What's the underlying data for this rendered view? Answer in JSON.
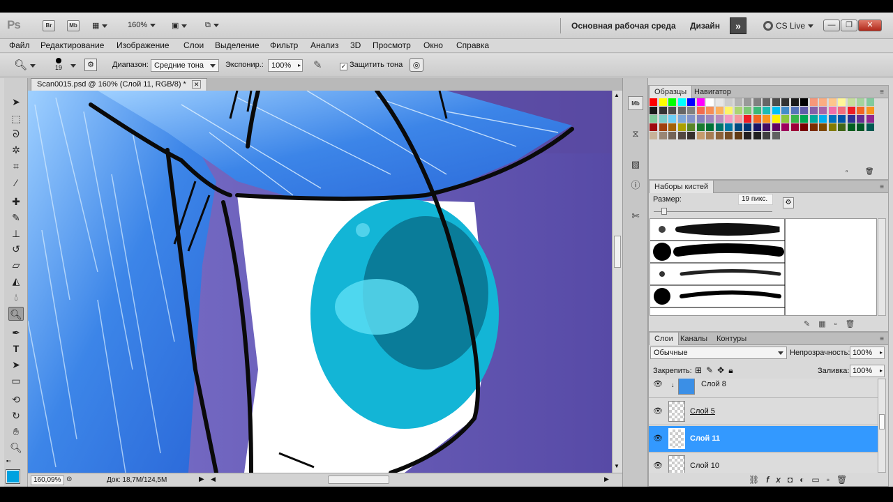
{
  "app": {
    "logo": "Ps",
    "bridge": "Br",
    "minibridge": "Mb",
    "zoom_select": "160%",
    "workspace": "Основная рабочая среда",
    "design": "Дизайн",
    "cslive": "CS Live"
  },
  "menu": [
    "Файл",
    "Редактирование",
    "Изображение",
    "Слои",
    "Выделение",
    "Фильтр",
    "Анализ",
    "3D",
    "Просмотр",
    "Окно",
    "Справка"
  ],
  "options": {
    "brush_size": "19",
    "range_label": "Диапазон:",
    "range_value": "Средние тона",
    "exposure_label": "Экспонир.:",
    "exposure_value": "100%",
    "protect_tones": "Защитить тона"
  },
  "document": {
    "tab_title": "Scan0015.psd @ 160% (Слой 11, RGB/8) *",
    "zoom": "160,09%",
    "doc_info": "Док: 18,7M/124,5M"
  },
  "panels": {
    "swatches_tab": "Образцы",
    "navigator_tab": "Навигатор",
    "brush_presets_tab": "Наборы кистей",
    "size_label": "Размер:",
    "size_value": "19 пикс.",
    "layers_tab": "Слои",
    "channels_tab": "Каналы",
    "paths_tab": "Контуры",
    "blend_mode": "Обычные",
    "opacity_label": "Непрозрачность:",
    "opacity_value": "100%",
    "lock_label": "Закрепить:",
    "fill_label": "Заливка:",
    "fill_value": "100%"
  },
  "layers": [
    {
      "name": "Слой 8",
      "selected": false
    },
    {
      "name": "Слой 5",
      "selected": false
    },
    {
      "name": "Слой 11",
      "selected": true
    },
    {
      "name": "Слой 10",
      "selected": false
    }
  ],
  "colors": {
    "accent": "#3399ff",
    "foreground": "#00a2e0",
    "canvas_bg": "#7a6cc4",
    "hair": "#3d86e6",
    "iris": "#16b9d8"
  },
  "icons": [
    "zoom-icon",
    "move-icon",
    "marquee-icon",
    "lasso-icon",
    "quick-select-icon",
    "crop-icon",
    "eyedropper-icon",
    "healing-icon",
    "brush-icon",
    "stamp-icon",
    "history-brush-icon",
    "eraser-icon",
    "gradient-icon",
    "blur-icon",
    "dodge-icon",
    "pen-icon",
    "type-icon",
    "path-select-icon",
    "shape-icon",
    "3d-rotate-icon",
    "3d-orbit-icon",
    "hand-icon",
    "zoom-tool-icon"
  ]
}
